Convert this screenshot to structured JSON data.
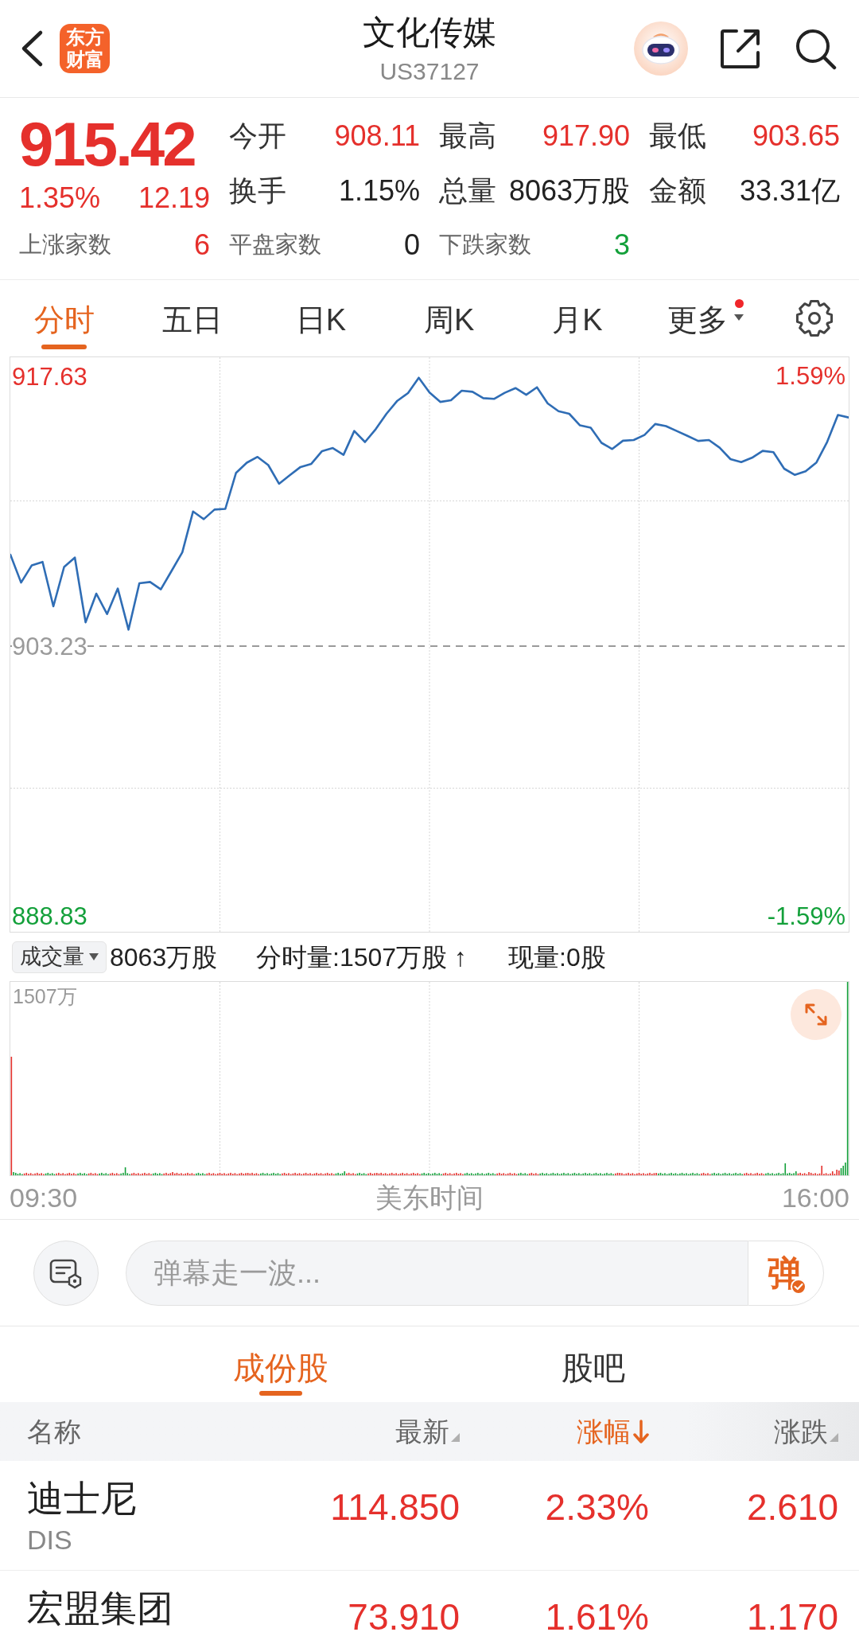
{
  "header": {
    "logo": "东方财富",
    "title": "文化传媒",
    "code": "US37127"
  },
  "quote": {
    "price": "915.42",
    "change_pct": "1.35%",
    "change": "12.19",
    "color": "#e5302c"
  },
  "stats": [
    {
      "label": "今开",
      "value": "908.11",
      "color": "#e5302c"
    },
    {
      "label": "最高",
      "value": "917.90",
      "color": "#e5302c"
    },
    {
      "label": "最低",
      "value": "903.65",
      "color": "#e5302c"
    },
    {
      "label": "换手",
      "value": "1.15%",
      "color": "#222222"
    },
    {
      "label": "总量",
      "value": "8063万股",
      "color": "#222222"
    },
    {
      "label": "金额",
      "value": "33.31亿",
      "color": "#222222"
    }
  ],
  "breadth": [
    {
      "label": "上涨家数",
      "value": "6",
      "color": "#e5302c"
    },
    {
      "label": "平盘家数",
      "value": "0",
      "color": "#222222"
    },
    {
      "label": "下跌家数",
      "value": "3",
      "color": "#13a03a"
    }
  ],
  "period_tabs": [
    {
      "label": "分时",
      "selected": true,
      "kind": "tab",
      "badge": false
    },
    {
      "label": "五日",
      "selected": false,
      "kind": "tab",
      "badge": false
    },
    {
      "label": "日K",
      "selected": false,
      "kind": "tab",
      "badge": false
    },
    {
      "label": "周K",
      "selected": false,
      "kind": "tab",
      "badge": false
    },
    {
      "label": "月K",
      "selected": false,
      "kind": "tab",
      "badge": false
    },
    {
      "label": "更多",
      "selected": false,
      "kind": "dropdown",
      "badge": true
    }
  ],
  "price_chart": {
    "right_labels": [
      {
        "text": "1.59%",
        "color": "#e5302c"
      },
      {
        "text": "-1.59%",
        "color": "#13a03a"
      }
    ],
    "chart_data": {
      "type": "line",
      "categories": [
        null,
        null,
        null,
        null,
        null,
        null,
        null,
        null,
        null,
        null,
        null,
        null,
        null,
        null,
        null,
        null,
        null,
        null,
        null,
        null,
        null,
        null,
        null,
        null,
        null,
        null,
        null,
        null,
        null,
        null,
        null,
        null,
        null,
        null,
        null,
        null,
        null,
        null,
        null,
        null,
        null,
        null,
        null,
        null,
        null,
        null,
        null,
        null,
        null,
        null,
        null,
        null,
        null,
        null,
        null,
        null,
        null,
        null,
        null,
        null,
        null,
        null,
        null,
        null,
        null,
        null,
        null,
        null,
        null,
        null,
        null,
        null,
        null,
        null,
        null,
        null,
        null,
        null,
        null
      ],
      "values": [
        908.11,
        906.62,
        907.54,
        907.72,
        905.35,
        907.45,
        907.95,
        904.5,
        906.03,
        904.94,
        906.3,
        904.11,
        906.58,
        906.65,
        906.26,
        907.24,
        908.23,
        910.41,
        910.0,
        910.51,
        910.55,
        912.47,
        913.01,
        913.32,
        912.88,
        911.89,
        912.34,
        912.78,
        912.95,
        913.63,
        913.79,
        913.43,
        914.7,
        914.11,
        914.8,
        915.62,
        916.31,
        916.72,
        917.54,
        916.75,
        916.25,
        916.34,
        916.85,
        916.79,
        916.45,
        916.41,
        916.74,
        916.99,
        916.63,
        917.03,
        916.17,
        915.76,
        915.62,
        915.0,
        914.88,
        914.07,
        913.74,
        914.18,
        914.22,
        914.49,
        915.07,
        914.96,
        914.7,
        914.44,
        914.17,
        914.22,
        913.81,
        913.2,
        913.04,
        913.27,
        913.64,
        913.57,
        912.69,
        912.36,
        912.55,
        913.02,
        914.12,
        915.55,
        915.42
      ],
      "ylim": [
        888.0,
        918.63
      ],
      "yticks": [
        {
          "value": 888.83,
          "label": "888.83"
        },
        {
          "value": 903.23,
          "label": "903.23"
        },
        {
          "value": 917.63,
          "label": "917.63"
        }
      ],
      "ref_lines": [
        {
          "axis": "y",
          "value": 903.23
        }
      ]
    }
  },
  "volume_legend": {
    "selector": "成交量",
    "total": "8063万股",
    "minute_volume": "分时量:1507万股 ↑",
    "current": "现量:0股"
  },
  "volume_chart": {
    "max_label": "1507万"
  },
  "time_axis": {
    "start": "09:30",
    "zone": "美东时间",
    "end": "16:00"
  },
  "danmaku": {
    "placeholder": "弹幕走一波...",
    "send_label": "弹",
    "on": true
  },
  "list_tabs": [
    {
      "label": "成份股",
      "selected": true
    },
    {
      "label": "股吧",
      "selected": false
    }
  ],
  "table": {
    "columns": [
      {
        "label": "名称",
        "kind": "plain",
        "selected": false
      },
      {
        "label": "最新",
        "kind": "sortable",
        "selected": false
      },
      {
        "label": "涨幅",
        "kind": "sortable",
        "selected": true
      },
      {
        "label": "涨跌",
        "kind": "sortable",
        "selected": false
      }
    ],
    "rows": [
      {
        "name": "迪士尼",
        "code": "DIS",
        "latest": "114.850",
        "change_pct": "2.33%",
        "change": "2.610",
        "color": "#e5302c"
      },
      {
        "name": "宏盟集团",
        "latest": "73.910",
        "change_pct": "1.61%",
        "change": "1.170",
        "color": "#e5302c"
      }
    ]
  }
}
